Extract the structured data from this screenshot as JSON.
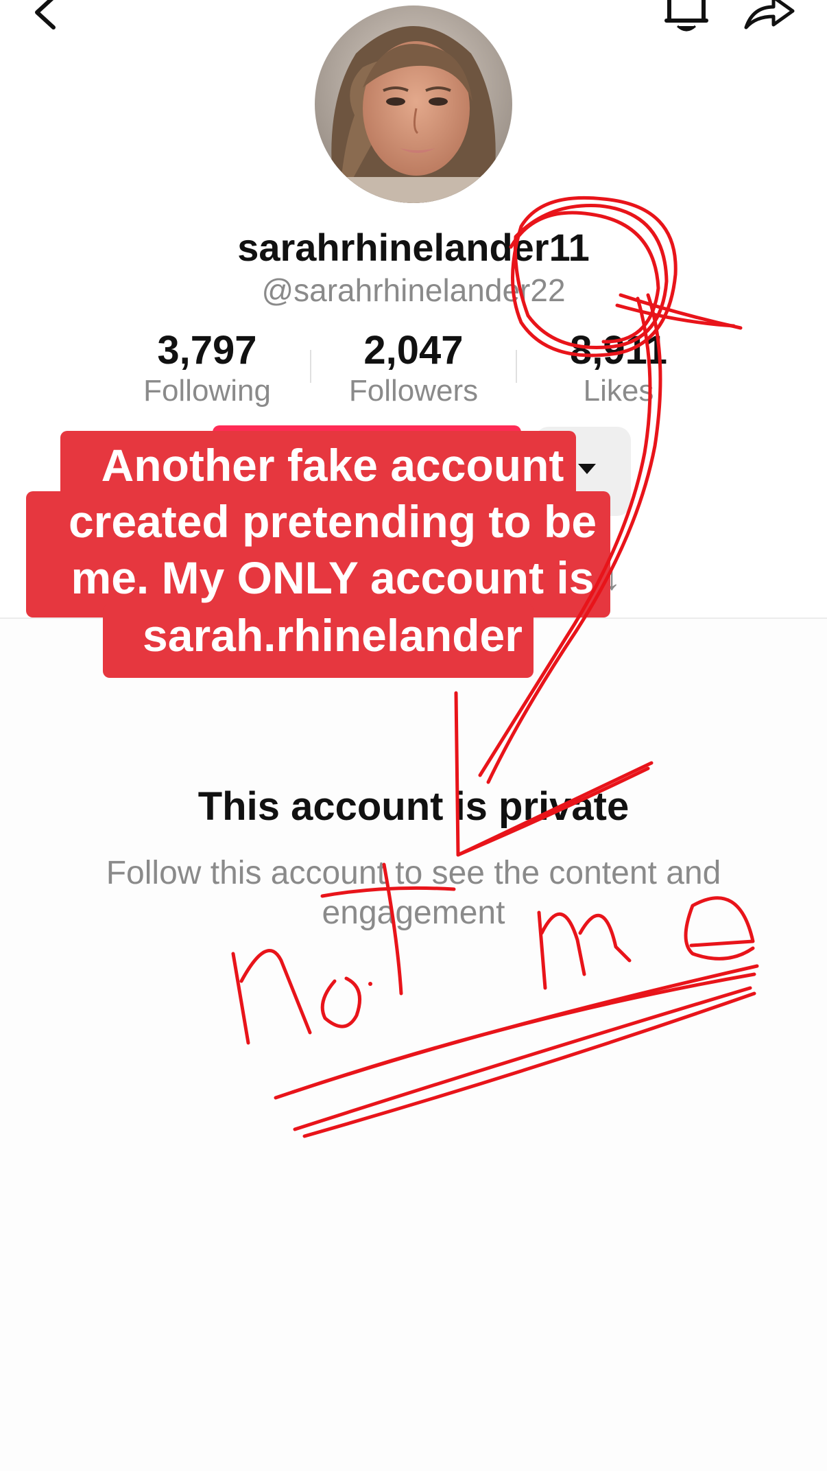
{
  "profile": {
    "display_name": "sarahrhinelander11",
    "handle": "@sarahrhinelander22"
  },
  "stats": [
    {
      "value": "3,797",
      "label": "Following"
    },
    {
      "value": "2,047",
      "label": "Followers"
    },
    {
      "value": "8,911",
      "label": "Likes"
    }
  ],
  "caption": {
    "lines": [
      "Another fake account",
      "created pretending to be",
      "me. My ONLY account is",
      "sarah.rhinelander"
    ]
  },
  "private_notice": {
    "title": "This account is private",
    "subtitle": "Follow this account to see the content and engagement"
  },
  "handwriting": {
    "text": "not me"
  },
  "icons": {
    "back": "chevron-left-icon",
    "notifications": "bell-icon",
    "share": "share-arrow-icon",
    "more": "caret-down-icon",
    "sort": "arrow-down-icon"
  },
  "colors": {
    "caption_background": "#e6373f",
    "follow_button": "#fe2c55",
    "annotation_ink": "#e8141a"
  }
}
